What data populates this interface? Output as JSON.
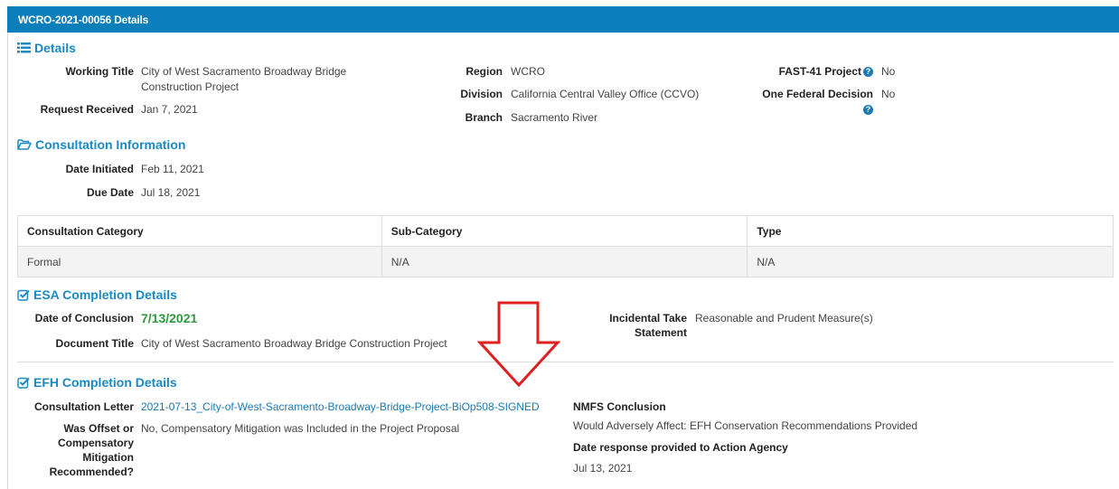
{
  "panel": {
    "title": "WCRO-2021-00056 Details"
  },
  "details": {
    "heading": "Details",
    "working_title_label": "Working Title",
    "working_title_line1": "City of West Sacramento Broadway Bridge",
    "working_title_line2": "Construction Project",
    "request_received_label": "Request Received",
    "request_received_value": "Jan 7, 2021",
    "region_label": "Region",
    "region_value": "WCRO",
    "division_label": "Division",
    "division_value": "California Central Valley Office (CCVO)",
    "branch_label": "Branch",
    "branch_value": "Sacramento River",
    "fast41_label": "FAST-41 Project",
    "fast41_value": "No",
    "one_federal_label": "One Federal Decision",
    "one_federal_value": "No",
    "help_glyph": "?"
  },
  "consultation": {
    "heading": "Consultation Information",
    "date_initiated_label": "Date Initiated",
    "date_initiated_value": "Feb 11, 2021",
    "due_date_label": "Due Date",
    "due_date_value": "Jul 18, 2021",
    "table": {
      "headers": [
        "Consultation Category",
        "Sub-Category",
        "Type"
      ],
      "row": [
        "Formal",
        "N/A",
        "N/A"
      ]
    }
  },
  "esa": {
    "heading": "ESA Completion Details",
    "date_conclusion_label": "Date of Conclusion",
    "date_conclusion_value": "7/13/2021",
    "document_title_label": "Document Title",
    "document_title_value": "City of West Sacramento Broadway Bridge Construction Project",
    "incidental_label_line1": "Incidental Take",
    "incidental_label_line2": "Statement",
    "incidental_value": "Reasonable and Prudent Measure(s)"
  },
  "efh": {
    "heading": "EFH Completion Details",
    "consultation_letter_label": "Consultation Letter",
    "consultation_letter_link": "2021-07-13_City-of-West-Sacramento-Broadway-Bridge-Project-BiOp508-SIGNED",
    "offset_label_line1": "Was Offset or",
    "offset_label_line2": "Compensatory",
    "offset_label_line3": "Mitigation",
    "offset_label_line4": "Recommended?",
    "offset_value": "No, Compensatory Mitigation was Included in the Project Proposal",
    "nmfs_label": "NMFS Conclusion",
    "nmfs_value": "Would Adversely Affect: EFH Conservation Recommendations Provided",
    "date_response_label": "Date response provided to Action Agency",
    "date_response_value": "Jul 13, 2021"
  },
  "colors": {
    "header_bg": "#0b7fb9",
    "accent": "#1a8ac4",
    "success_green": "#2e9a3e",
    "arrow_red": "#e02020"
  },
  "icons": [
    "list-icon",
    "folder-open-icon",
    "check-square-icon",
    "question-circle-icon",
    "down-arrow-annotation"
  ]
}
